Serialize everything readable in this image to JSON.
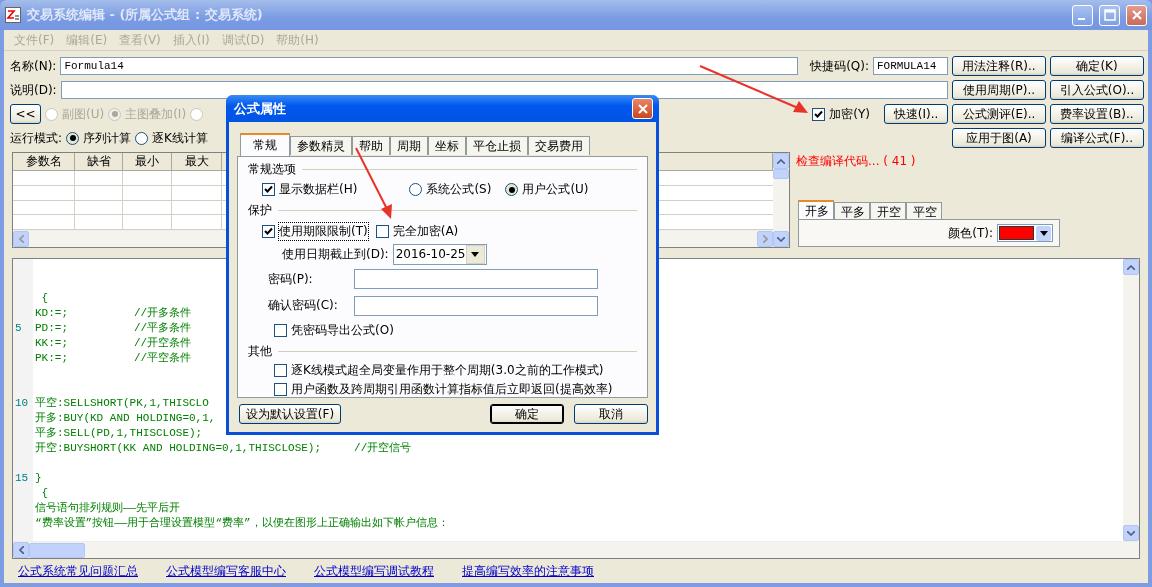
{
  "window": {
    "title": "交易系统编辑 - (所属公式组 : 交易系统)"
  },
  "menu": [
    {
      "label": "文件(F)",
      "disabled": true
    },
    {
      "label": "编辑(E)",
      "disabled": true
    },
    {
      "label": "查看(V)",
      "disabled": true
    },
    {
      "label": "插入(I)",
      "disabled": true
    },
    {
      "label": "调试(D)",
      "disabled": true
    },
    {
      "label": "帮助(H)",
      "disabled": true
    }
  ],
  "name_field": {
    "label": "名称(N):",
    "value": "Formula14"
  },
  "shortcut_field": {
    "label": "快捷码(Q):",
    "value": "FORMULA14"
  },
  "description_field": {
    "label": "说明(D):"
  },
  "collapse_button": {
    "label": "<<"
  },
  "chart_type_radios": [
    {
      "label": "副图(U)",
      "selected": false,
      "disabled": true
    },
    {
      "label": "主图叠加(I)",
      "selected": true,
      "disabled": true
    },
    {
      "selected": false,
      "disabled": true
    }
  ],
  "encrypt_checkbox": {
    "label": "加密(Y)",
    "checked": true
  },
  "quick_button": {
    "label": "快速(I).."
  },
  "run_mode": {
    "label": "运行模式:",
    "options": [
      {
        "label": "序列计算",
        "selected": true
      },
      {
        "label": "逐K线计算",
        "selected": false
      }
    ]
  },
  "side_buttons": [
    "用法注释(R)..",
    "确定(K)",
    "使用周期(P)..",
    "引入公式(O)..",
    "公式测评(E)..",
    "费率设置(B)..",
    "应用于图(A)",
    "编译公式(F).."
  ],
  "params_table": {
    "columns": [
      "参数名",
      "缺省",
      "最小",
      "最大"
    ]
  },
  "compile_status": "检查编译代码... ( 41 )",
  "signal_tabs": [
    {
      "label": "开多",
      "selected": true
    },
    {
      "label": "平多",
      "selected": false
    },
    {
      "label": "开空",
      "selected": false
    },
    {
      "label": "平空",
      "selected": false
    }
  ],
  "color_picker": {
    "label": "颜色(T):",
    "color": "#ff0000"
  },
  "editor": {
    "lines": [
      {
        "kind": "blank"
      },
      {
        "kind": "blank"
      },
      {
        "kind": "code",
        "text": " {"
      },
      {
        "kind": "code",
        "text": "KD:=;          //开多条件"
      },
      {
        "kind": "code",
        "number": "5",
        "text": "PD:=;          //平多条件"
      },
      {
        "kind": "code",
        "text": "KK:=;          //开空条件"
      },
      {
        "kind": "code",
        "text": "PK:=;          //平空条件"
      },
      {
        "kind": "blank"
      },
      {
        "kind": "blank"
      },
      {
        "kind": "code",
        "number": "10",
        "text": "平空:SELLSHORT(PK,1,THISCLO"
      },
      {
        "kind": "code",
        "text": "开多:BUY(KD AND HOLDING=0,1,"
      },
      {
        "kind": "code",
        "text": "平多:SELL(PD,1,THISCLOSE);"
      },
      {
        "kind": "code",
        "text": "开空:BUYSHORT(KK AND HOLDING=0,1,THISCLOSE);     //开空信号"
      },
      {
        "kind": "blank"
      },
      {
        "kind": "code",
        "number": "15",
        "text": "}"
      },
      {
        "kind": "code",
        "text": " {"
      },
      {
        "kind": "code",
        "text": "信号语句排列规则——先平后开"
      },
      {
        "kind": "code",
        "text": "“费率设置”按钮——用于合理设置模型“费率”，以便在图形上正确输出如下帐户信息："
      }
    ]
  },
  "footer_links": [
    "公式系统常见问题汇总",
    "公式模型编写客服中心",
    "公式模型编写调试教程",
    "提高编写效率的注意事项"
  ],
  "dialog": {
    "title": "公式属性",
    "tabs": [
      {
        "label": "常规",
        "selected": true
      },
      {
        "label": "参数精灵",
        "selected": false
      },
      {
        "label": "帮助",
        "selected": false
      },
      {
        "label": "周期",
        "selected": false
      },
      {
        "label": "坐标",
        "selected": false
      },
      {
        "label": "平仓止损",
        "selected": false
      },
      {
        "label": "交易费用",
        "selected": false
      }
    ],
    "general": {
      "title": "常规选项",
      "show_data_bar": {
        "label": "显示数据栏(H)",
        "checked": true
      },
      "formula_type": [
        {
          "label": "系统公式(S)",
          "selected": false
        },
        {
          "label": "用户公式(U)",
          "selected": true
        }
      ]
    },
    "protection": {
      "title": "保护",
      "time_limit": {
        "label": "使用期限限制(T)",
        "checked": true
      },
      "full_encrypt": {
        "label": "完全加密(A)",
        "checked": false
      },
      "expiry": {
        "label": "使用日期截止到(D):",
        "value": "2016-10-25"
      },
      "password": {
        "label": "密码(P):"
      },
      "confirm_password": {
        "label": "确认密码(C):"
      },
      "export_with_password": {
        "label": "凭密码导出公式(O)",
        "checked": false
      }
    },
    "other": {
      "title": "其他",
      "options": [
        {
          "label": "逐K线模式超全局变量作用于整个周期(3.0之前的工作模式)",
          "checked": false
        },
        {
          "label": "用户函数及跨周期引用函数计算指标值后立即返回(提高效率)",
          "checked": false
        }
      ]
    },
    "buttons": [
      {
        "label": "设为默认设置(F)",
        "default": false
      },
      {
        "label": "确定",
        "default": true
      },
      {
        "label": "取消",
        "default": false
      }
    ]
  }
}
